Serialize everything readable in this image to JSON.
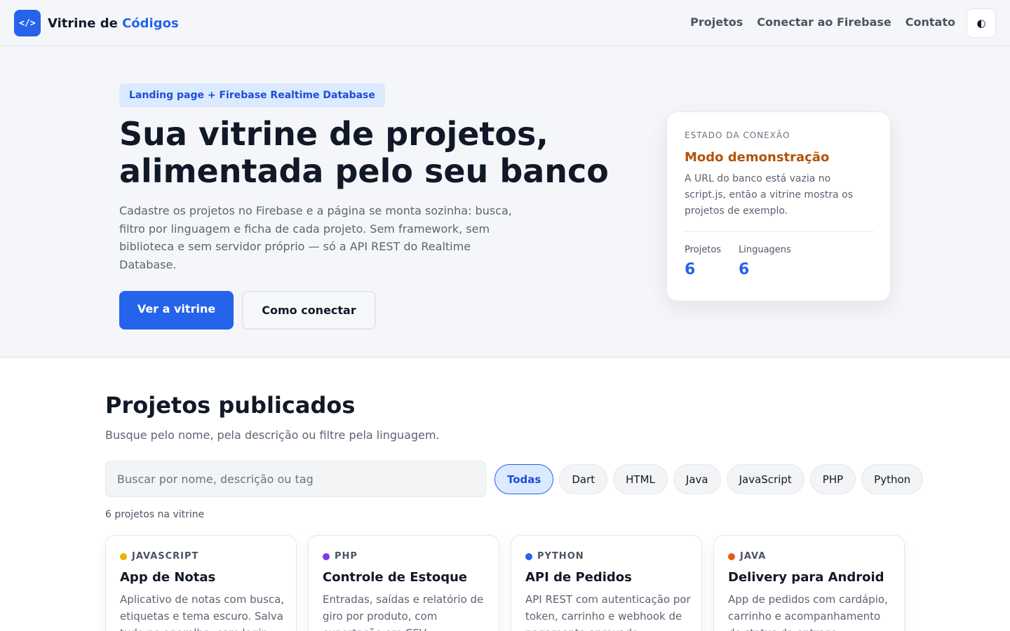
{
  "header": {
    "logo_icon": "code-brackets-icon",
    "logo_glyph": "</>",
    "brand_prefix": "Vitrine de ",
    "brand_accent": "Códigos",
    "nav": [
      {
        "label": "Projetos"
      },
      {
        "label": "Conectar ao Firebase"
      },
      {
        "label": "Contato"
      }
    ],
    "theme_toggle_icon": "contrast-icon",
    "theme_toggle_glyph": "◐"
  },
  "hero": {
    "eyebrow": "Landing page + Firebase Realtime Database",
    "title_line1": "Sua vitrine de projetos,",
    "title_line2": "alimentada pelo seu banco",
    "lead": "Cadastre os projetos no Firebase e a página se monta sozinha: busca, filtro por linguagem e ficha de cada projeto. Sem framework, sem biblioteca e sem servidor próprio — só a API REST do Realtime Database.",
    "primary_cta": "Ver a vitrine",
    "secondary_cta": "Como conectar"
  },
  "status_card": {
    "eyebrow": "ESTADO DA CONEXÃO",
    "mode": "Modo demonstração",
    "description": "A URL do banco está vazia no script.js, então a vitrine mostra os projetos de exemplo.",
    "stats": [
      {
        "label": "Projetos",
        "value": "6"
      },
      {
        "label": "Linguagens",
        "value": "6"
      }
    ]
  },
  "projects": {
    "title": "Projetos publicados",
    "subtitle": "Busque pelo nome, pela descrição ou filtre pela linguagem.",
    "search_placeholder": "Buscar por nome, descrição ou tag",
    "filters": [
      {
        "label": "Todas",
        "active": true
      },
      {
        "label": "Dart",
        "active": false
      },
      {
        "label": "HTML",
        "active": false
      },
      {
        "label": "Java",
        "active": false
      },
      {
        "label": "JavaScript",
        "active": false
      },
      {
        "label": "PHP",
        "active": false
      },
      {
        "label": "Python",
        "active": false
      }
    ],
    "count_text": "6 projetos na vitrine",
    "cards": [
      {
        "language": "JAVASCRIPT",
        "color": "#eab308",
        "title": "App de Notas",
        "description": "Aplicativo de notas com busca, etiquetas e tema escuro. Salva tudo no aparelho, com login opcional."
      },
      {
        "language": "PHP",
        "color": "#7c3aed",
        "title": "Controle de Estoque",
        "description": "Entradas, saídas e relatório de giro por produto, com exportação em CSV."
      },
      {
        "language": "PYTHON",
        "color": "#2563eb",
        "title": "API de Pedidos",
        "description": "API REST com autenticação por token, carrinho e webhook de pagamento aprovado."
      },
      {
        "language": "JAVA",
        "color": "#ea580c",
        "title": "Delivery para Android",
        "description": "App de pedidos com cardápio, carrinho e acompanhamento do status da entrega."
      }
    ]
  },
  "colors": {
    "accent": "#2563eb",
    "demo_mode": "#b45309",
    "chip_active_bg": "#dbeafe"
  }
}
